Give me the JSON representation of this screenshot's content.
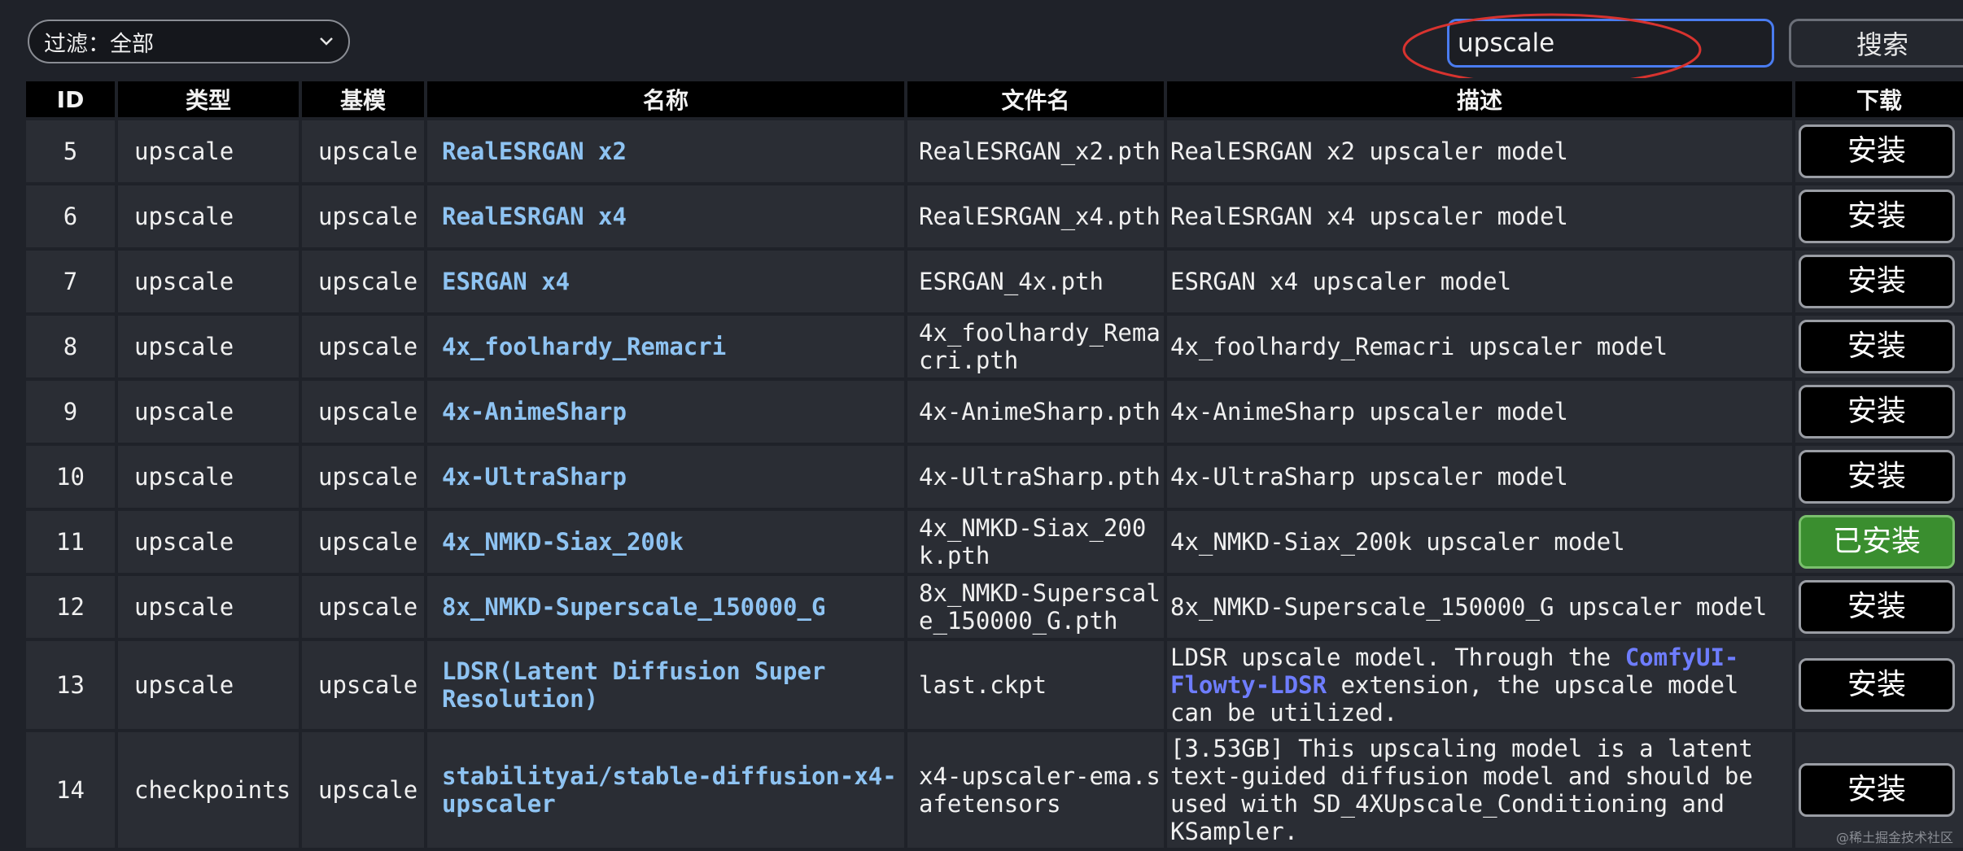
{
  "toolbar": {
    "filter_label": "过滤：全部",
    "search_value": "upscale",
    "search_button": "搜索"
  },
  "table": {
    "headers": [
      "ID",
      "类型",
      "基模",
      "名称",
      "文件名",
      "描述",
      "下载"
    ],
    "rows": [
      {
        "id": "5",
        "type": "upscale",
        "base": "upscale",
        "name": "RealESRGAN x2",
        "file": "RealESRGAN_x2.pth",
        "desc": "RealESRGAN x2 upscaler model",
        "action": "安装",
        "installed": false
      },
      {
        "id": "6",
        "type": "upscale",
        "base": "upscale",
        "name": "RealESRGAN x4",
        "file": "RealESRGAN_x4.pth",
        "desc": "RealESRGAN x4 upscaler model",
        "action": "安装",
        "installed": false
      },
      {
        "id": "7",
        "type": "upscale",
        "base": "upscale",
        "name": "ESRGAN x4",
        "file": "ESRGAN_4x.pth",
        "desc": "ESRGAN x4 upscaler model",
        "action": "安装",
        "installed": false
      },
      {
        "id": "8",
        "type": "upscale",
        "base": "upscale",
        "name": "4x_foolhardy_Remacri",
        "file": "4x_foolhardy_Remacri.pth",
        "desc": "4x_foolhardy_Remacri upscaler model",
        "action": "安装",
        "installed": false
      },
      {
        "id": "9",
        "type": "upscale",
        "base": "upscale",
        "name": "4x-AnimeSharp",
        "file": "4x-AnimeSharp.pth",
        "desc": "4x-AnimeSharp upscaler model",
        "action": "安装",
        "installed": false
      },
      {
        "id": "10",
        "type": "upscale",
        "base": "upscale",
        "name": "4x-UltraSharp",
        "file": "4x-UltraSharp.pth",
        "desc": "4x-UltraSharp upscaler model",
        "action": "安装",
        "installed": false
      },
      {
        "id": "11",
        "type": "upscale",
        "base": "upscale",
        "name": "4x_NMKD-Siax_200k",
        "file": "4x_NMKD-Siax_200k.pth",
        "desc": "4x_NMKD-Siax_200k upscaler model",
        "action": "已安装",
        "installed": true
      },
      {
        "id": "12",
        "type": "upscale",
        "base": "upscale",
        "name": "8x_NMKD-Superscale_150000_G",
        "file": "8x_NMKD-Superscale_150000_G.pth",
        "desc": "8x_NMKD-Superscale_150000_G upscaler model",
        "action": "安装",
        "installed": false
      },
      {
        "id": "13",
        "type": "upscale",
        "base": "upscale",
        "name": "LDSR(Latent Diffusion Super Resolution)",
        "file": "last.ckpt",
        "desc_pre": "LDSR upscale model. Through the ",
        "desc_link": "ComfyUI-Flowty-LDSR",
        "desc_post": " extension, the upscale model can be utilized.",
        "action": "安装",
        "installed": false
      },
      {
        "id": "14",
        "type": "checkpoints",
        "base": "upscale",
        "name": "stabilityai/stable-diffusion-x4-upscaler",
        "file": "x4-upscaler-ema.safetensors",
        "desc": "[3.53GB] This upscaling model is a latent text-guided diffusion model and should be used with SD_4XUpscale_Conditioning and KSampler.",
        "action": "安装",
        "installed": false
      }
    ]
  },
  "watermark": "@稀土掘金技术社区",
  "colors": {
    "accent": "#4a7cf0",
    "annotation": "#d8332f",
    "installed_bg": "#3a8e2f",
    "name_link": "#8ec3f2",
    "ext_link": "#6e7dff"
  }
}
